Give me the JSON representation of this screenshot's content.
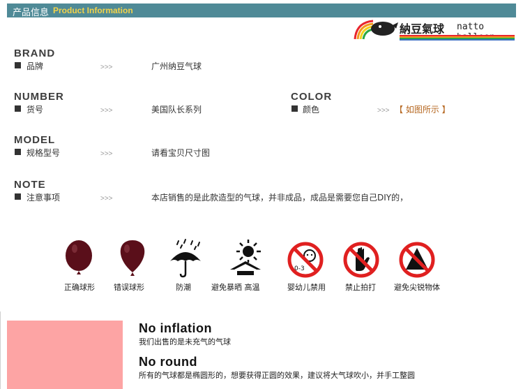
{
  "header": {
    "title_zh": "产品信息",
    "title_en": "Product Information"
  },
  "logo": {
    "name_zh": "納豆氣球",
    "name_en": "natto balloon"
  },
  "info": {
    "arrow": ">>>",
    "brand": {
      "caption": "BRAND",
      "label": "品牌",
      "value": "广州纳豆气球"
    },
    "number": {
      "caption": "NUMBER",
      "label": "货号",
      "value": "美国队长系列"
    },
    "color": {
      "caption": "COLOR",
      "label": "颜色",
      "value": "【 如图所示 】"
    },
    "model": {
      "caption": "MODEL",
      "label": "规格型号",
      "value": "请看宝贝尺寸图"
    },
    "note": {
      "caption": "NOTE",
      "label": "注意事项",
      "value": "本店销售的是此款造型的气球，并非成品，成品是需要您自己DIY的，"
    }
  },
  "icons": [
    {
      "name": "correct-balloon-icon",
      "label": "正确球形"
    },
    {
      "name": "wrong-balloon-icon",
      "label": "错误球形"
    },
    {
      "name": "umbrella-icon",
      "label": "防潮"
    },
    {
      "name": "sun-icon",
      "label": "避免暴晒 高温"
    },
    {
      "name": "no-infant-icon",
      "label": "婴幼儿禁用"
    },
    {
      "name": "no-hit-icon",
      "label": "禁止拍打"
    },
    {
      "name": "no-sharp-icon",
      "label": "避免尖锐物体"
    }
  ],
  "notes": [
    {
      "title": "No inflation",
      "text": "我们出售的是未充气的气球"
    },
    {
      "title": "No round",
      "text": "所有的气球都是椭圆形的，想要获得正圆的效果，建议将大气球吹小，并手工整圆"
    }
  ],
  "colors": {
    "header_bg": "#4f8a97",
    "header_en": "#f3d34a",
    "accent_value": "#b5661f",
    "pink_block": "#fda4a4",
    "balloon": "#5a0f1a",
    "warning_red": "#e02020"
  }
}
